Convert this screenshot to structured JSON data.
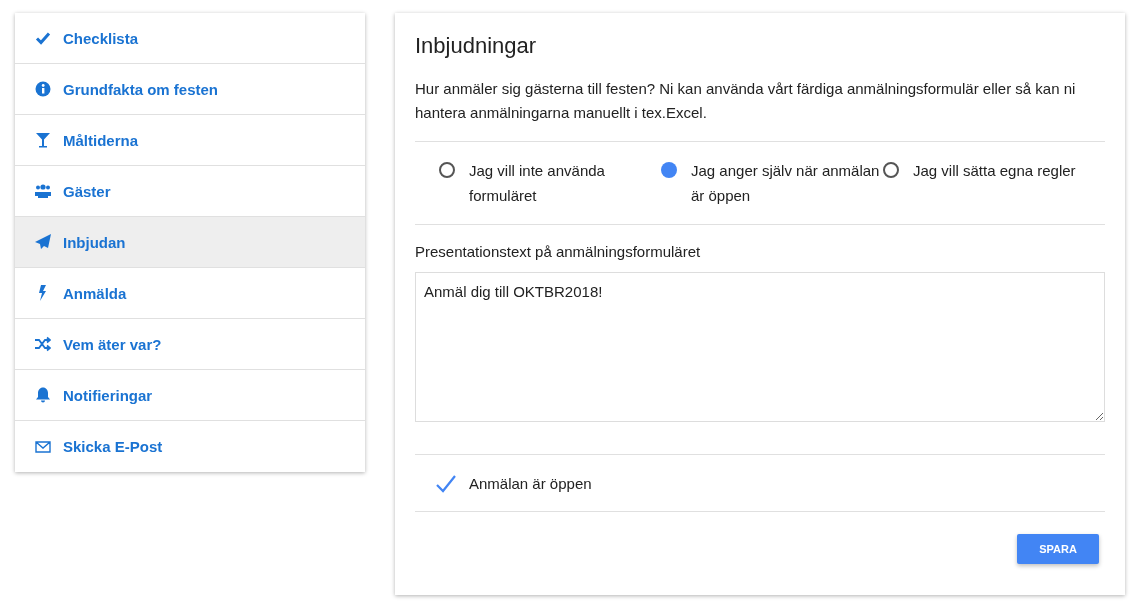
{
  "sidebar": {
    "items": [
      {
        "label": "Checklista",
        "selected": false
      },
      {
        "label": "Grundfakta om festen",
        "selected": false
      },
      {
        "label": "Måltiderna",
        "selected": false
      },
      {
        "label": "Gäster",
        "selected": false
      },
      {
        "label": "Inbjudan",
        "selected": true
      },
      {
        "label": "Anmälda",
        "selected": false
      },
      {
        "label": "Vem äter var?",
        "selected": false
      },
      {
        "label": "Notifieringar",
        "selected": false
      },
      {
        "label": "Skicka E-Post",
        "selected": false
      }
    ]
  },
  "panel": {
    "title": "Inbjudningar",
    "description": "Hur anmäler sig gästerna till festen? Ni kan använda vårt färdiga anmälningsformulär eller så kan ni hantera anmälningarna manuellt i tex.Excel.",
    "options": [
      {
        "label": "Jag vill inte använda formuläret",
        "selected": false
      },
      {
        "label": "Jag anger själv när anmälan är öppen",
        "selected": true
      },
      {
        "label": "Jag vill sätta egna regler",
        "selected": false
      }
    ],
    "text_label": "Presentationstext på anmälningsformuläret",
    "text_value": "Anmäl dig till OKTBR2018!",
    "open_check": {
      "label": "Anmälan är öppen",
      "checked": true
    },
    "save_button": "SPARA"
  }
}
